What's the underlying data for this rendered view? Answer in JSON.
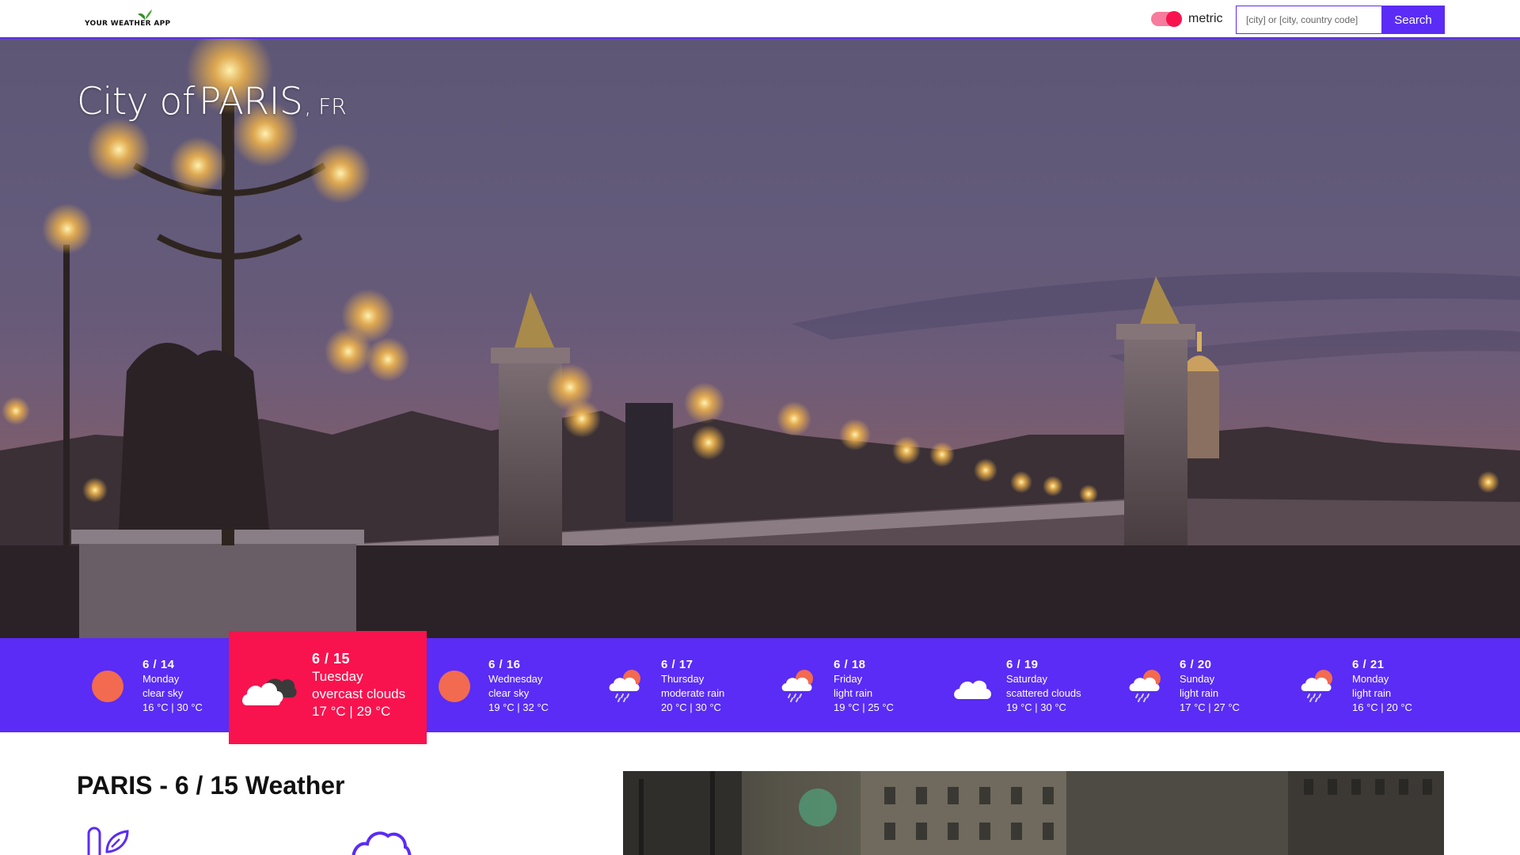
{
  "header": {
    "logo_text": "YOUR WEATHER APP",
    "unit_label": "metric",
    "unit_toggle_on": true,
    "search_placeholder": "[city] or [city, country code]",
    "search_button": "Search"
  },
  "hero": {
    "prefix": "City of",
    "city": "PARIS",
    "country": ", FR"
  },
  "forecast": [
    {
      "date": "6 / 14",
      "day": "Monday",
      "description": "clear sky",
      "temps": "16 °C | 30 °C",
      "icon": "sun-icon",
      "active": false
    },
    {
      "date": "6 / 15",
      "day": "Tuesday",
      "description": "overcast clouds",
      "temps": "17 °C | 29 °C",
      "icon": "overcast-clouds-icon",
      "active": true
    },
    {
      "date": "6 / 16",
      "day": "Wednesday",
      "description": "clear sky",
      "temps": "19 °C | 32 °C",
      "icon": "sun-icon",
      "active": false
    },
    {
      "date": "6 / 17",
      "day": "Thursday",
      "description": "moderate rain",
      "temps": "20 °C | 30 °C",
      "icon": "sun-rain-icon",
      "active": false
    },
    {
      "date": "6 / 18",
      "day": "Friday",
      "description": "light rain",
      "temps": "19 °C | 25 °C",
      "icon": "sun-rain-icon",
      "active": false
    },
    {
      "date": "6 / 19",
      "day": "Saturday",
      "description": "scattered clouds",
      "temps": "19 °C | 30 °C",
      "icon": "cloud-icon",
      "active": false
    },
    {
      "date": "6 / 20",
      "day": "Sunday",
      "description": "light rain",
      "temps": "17 °C | 27 °C",
      "icon": "sun-rain-icon",
      "active": false
    },
    {
      "date": "6 / 21",
      "day": "Monday",
      "description": "light rain",
      "temps": "16 °C | 20 °C",
      "icon": "sun-rain-icon",
      "active": false
    }
  ],
  "details": {
    "title": "PARIS - 6 / 15 Weather"
  },
  "colors": {
    "accent": "#5a2cf5",
    "highlight": "#f8134e",
    "sun": "#f26a4f"
  }
}
